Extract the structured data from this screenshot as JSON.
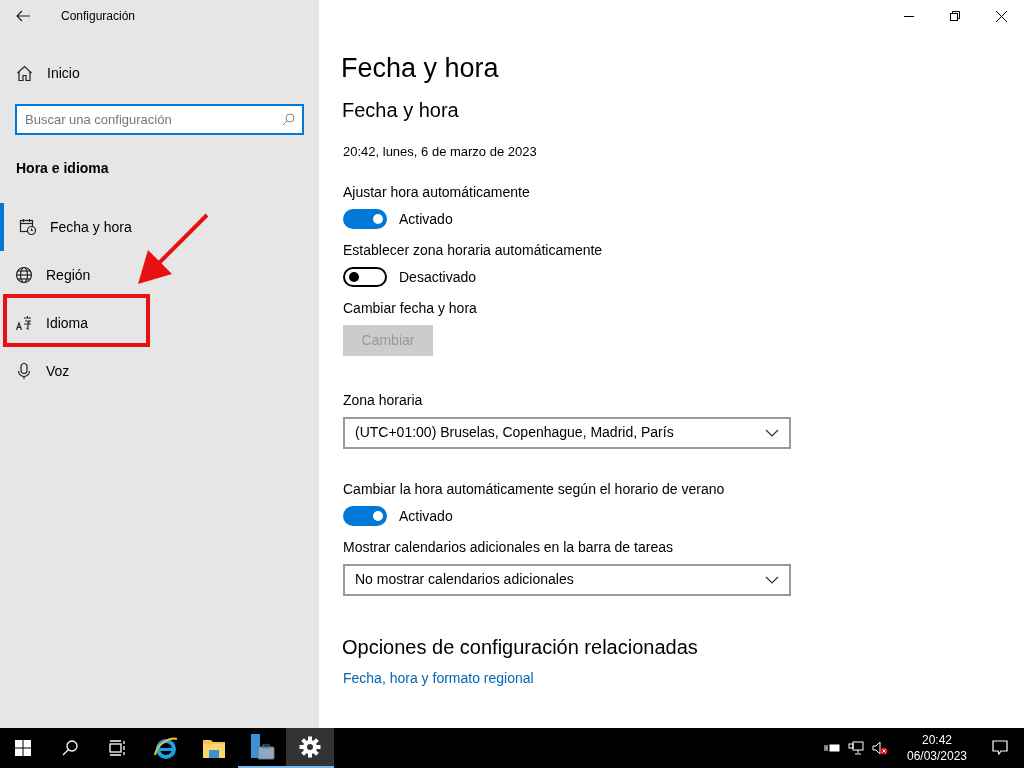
{
  "window": {
    "title": "Configuración"
  },
  "sidebar": {
    "home": "Inicio",
    "search": {
      "placeholder": "Buscar una configuración"
    },
    "section": "Hora e idioma",
    "items": [
      {
        "label": "Fecha y hora",
        "kind": "calendar",
        "selected": true
      },
      {
        "label": "Región",
        "kind": "globe",
        "selected": false
      },
      {
        "label": "Idioma",
        "kind": "language",
        "selected": false
      },
      {
        "label": "Voz",
        "kind": "microphone",
        "selected": false
      }
    ]
  },
  "main": {
    "title": "Fecha y hora",
    "subtitle": "Fecha y hora",
    "current": "20:42, lunes, 6 de marzo de 2023",
    "settings": [
      {
        "kind": "toggle",
        "label": "Ajustar hora automáticamente",
        "on": true,
        "state": "Activado"
      },
      {
        "kind": "toggle",
        "label": "Establecer zona horaria automáticamente",
        "on": false,
        "state": "Desactivado"
      },
      {
        "kind": "button",
        "label": "Cambiar fecha y hora",
        "button": "Cambiar",
        "disabled": true
      },
      {
        "kind": "dropdown",
        "label": "Zona horaria",
        "value": "(UTC+01:00) Bruselas, Copenhague, Madrid, París"
      },
      {
        "kind": "toggle",
        "label": "Cambiar la hora automáticamente según el horario de verano",
        "on": true,
        "state": "Activado"
      },
      {
        "kind": "dropdown",
        "label": "Mostrar calendarios adicionales en la barra de tareas",
        "value": "No mostrar calendarios adicionales"
      }
    ],
    "related": {
      "heading": "Opciones de configuración relacionadas",
      "link": "Fecha, hora y formato regional"
    }
  },
  "taskbar": {
    "apps": [
      {
        "kind": "browser",
        "active": false,
        "running": false
      },
      {
        "kind": "folder",
        "active": false,
        "running": false
      },
      {
        "kind": "server",
        "active": false,
        "running": true
      },
      {
        "kind": "settings",
        "active": true,
        "running": true
      }
    ],
    "time": "20:42",
    "date": "06/03/2023"
  }
}
